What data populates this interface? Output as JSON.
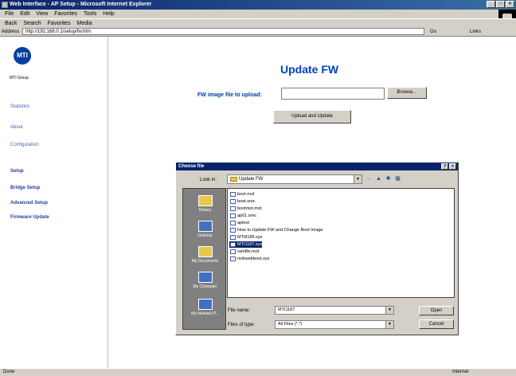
{
  "window": {
    "title": "Web Interface - AP Setup - Microsoft Internet Explorer"
  },
  "menu": [
    "File",
    "Edit",
    "View",
    "Favorites",
    "Tools",
    "Help"
  ],
  "toolbar": {
    "items": [
      "Back",
      "Search",
      "Favorites",
      "Media"
    ]
  },
  "address": {
    "label": "Address",
    "url": "http://192.168.0.1/setup/fw.htm",
    "go": "Go",
    "links": "Links"
  },
  "sidebar": {
    "logo": "MTI",
    "company": "MTI Group",
    "items": [
      "Statistics",
      "About",
      "Configuration",
      "Setup",
      "Bridge Setup",
      "Advanced Setup",
      "Firmware Update"
    ]
  },
  "main": {
    "title": "Update FW",
    "fw_label": "FW image file to upload:",
    "fw_value": "",
    "browse": "Browse...",
    "upload": "Upload and Update"
  },
  "dialog": {
    "title": "Choose file",
    "look_in_label": "Look in:",
    "look_in_value": "Update FW",
    "places": [
      "History",
      "Desktop",
      "My Documents",
      "My Computer",
      "My Network P..."
    ],
    "files": [
      "boot.mot",
      "boot.srec",
      "bootmot.mot",
      "ap01.srec",
      "aptest",
      "How to Update FW and Change Boot Image",
      "MTI8185.sys",
      "MTI1187.sys",
      "ramfile.mot",
      "redrwebboot.sys"
    ],
    "selected_index": 7,
    "filename_label": "File name:",
    "filename_value": "MTI1187",
    "filetype_label": "Files of type:",
    "filetype_value": "All Files (*.*)",
    "open": "Open",
    "cancel": "Cancel"
  },
  "status": {
    "left": "Done",
    "right": "Internet"
  }
}
